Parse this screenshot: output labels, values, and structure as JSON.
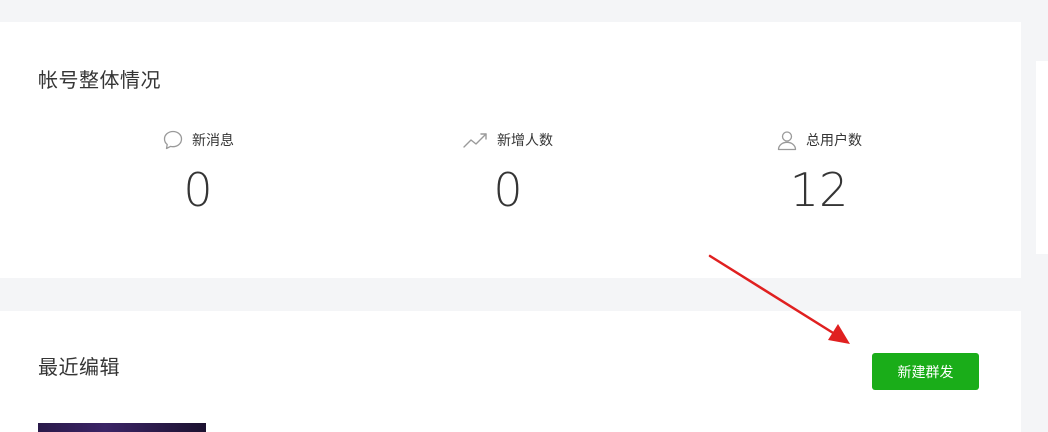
{
  "overview": {
    "title": "帐号整体情况",
    "stats": [
      {
        "label": "新消息",
        "value": "0",
        "icon": "chat-bubble-icon"
      },
      {
        "label": "新增人数",
        "value": "0",
        "icon": "trend-up-icon"
      },
      {
        "label": "总用户数",
        "value": "12",
        "icon": "user-icon"
      }
    ]
  },
  "recent": {
    "title": "最近编辑",
    "new_broadcast_label": "新建群发"
  },
  "colors": {
    "accent_green": "#1aad19",
    "annotation_red": "#e02020",
    "icon_gray": "#9a9a9a"
  }
}
